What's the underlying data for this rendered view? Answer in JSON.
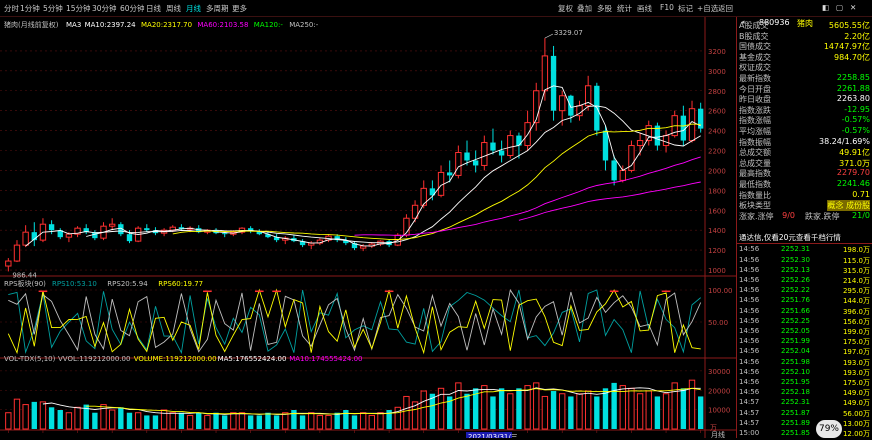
{
  "toolbar": {
    "periods": [
      "分时",
      "1分钟",
      "5分钟",
      "15分钟",
      "30分钟",
      "60分钟",
      "日线",
      "周线",
      "月线",
      "多周期",
      "更多"
    ],
    "active_period": "月线",
    "tools": [
      "复权",
      "叠加",
      "多股",
      "统计",
      "画线",
      "F10",
      "标记",
      "+自选",
      "返回"
    ]
  },
  "main_panel": {
    "title_stock": "猪肉(月线前复权)",
    "ma": [
      {
        "label": "MA3",
        "value": "",
        "color": "#ffffff"
      },
      {
        "label": "MA10:",
        "value": "2397.24",
        "color": "#ffffff"
      },
      {
        "label": "MA20:",
        "value": "2317.70",
        "color": "#ffff00"
      },
      {
        "label": "MA60:",
        "value": "2103.58",
        "color": "#ff00ff"
      },
      {
        "label": "MA120:",
        "value": "-",
        "color": "#00ff00"
      },
      {
        "label": "MA250:",
        "value": "-",
        "color": "#c0c0c0"
      }
    ],
    "price_ticks": [
      "3200",
      "3000",
      "2800",
      "2600",
      "2400",
      "2200",
      "2000",
      "1800",
      "1600",
      "1400",
      "1200",
      "1000"
    ],
    "high_label": "3329.07",
    "low_label": "986.44"
  },
  "rps_panel": {
    "title": "RPS板块(90)",
    "items": [
      {
        "label": "RPS10:",
        "value": "53.10",
        "color": "#00a0a0"
      },
      {
        "label": "RPS20:",
        "value": "5.94",
        "color": "#c0c0c0"
      },
      {
        "label": "RPS60:",
        "value": "19.77",
        "color": "#ffff00"
      }
    ],
    "ticks": [
      "100.00",
      "50.00"
    ]
  },
  "vol_panel": {
    "title": "VOL-TDX(5,10)",
    "items": [
      {
        "label": "VVOL:",
        "value": "119212000.00",
        "color": "#c0c0c0"
      },
      {
        "label": "VOLUME:",
        "value": "119212000.00",
        "color": "#ffff00"
      },
      {
        "label": "MA5:",
        "value": "176552424.00",
        "color": "#ffffff"
      },
      {
        "label": "MA10:",
        "value": "174555424.00",
        "color": "#ff00ff"
      }
    ],
    "ticks": [
      "30000",
      "20000",
      "10000"
    ],
    "unit": "万"
  },
  "date_label": "2021/03/31/三",
  "bottom_right_label": "月线",
  "side": {
    "code": "880936",
    "name": "猪肉",
    "stats": [
      {
        "label": "A股成交",
        "value": "5605.55亿",
        "color": "#ffff00"
      },
      {
        "label": "B股成交",
        "value": "2.20亿",
        "color": "#ffff00"
      },
      {
        "label": "国债成交",
        "value": "14747.97亿",
        "color": "#ffff00"
      },
      {
        "label": "基金成交",
        "value": "984.70亿",
        "color": "#ffff00"
      },
      {
        "label": "权证成交",
        "value": "",
        "color": "#ffff00"
      },
      {
        "label": "最新指数",
        "value": "2258.85",
        "color": "#00ff00"
      },
      {
        "label": "今日开盘",
        "value": "2261.88",
        "color": "#00ff00"
      },
      {
        "label": "昨日收盘",
        "value": "2263.80",
        "color": "#ffffff"
      },
      {
        "label": "指数涨跌",
        "value": "-12.95",
        "color": "#00ff00"
      },
      {
        "label": "指数涨幅",
        "value": "-0.57%",
        "color": "#00ff00"
      },
      {
        "label": "平均涨幅",
        "value": "-0.57%",
        "color": "#00ff00"
      },
      {
        "label": "指数振幅",
        "value": "38.24/1.69%",
        "color": "#ffffff"
      },
      {
        "label": "总成交额",
        "value": "49.91亿",
        "color": "#ffff00"
      },
      {
        "label": "总成交量",
        "value": "371.0万",
        "color": "#ffff00"
      },
      {
        "label": "最高指数",
        "value": "2279.70",
        "color": "#ff4040"
      },
      {
        "label": "最低指数",
        "value": "2241.46",
        "color": "#00ff00"
      },
      {
        "label": "指数量比",
        "value": "0.71",
        "color": "#ffff00"
      },
      {
        "label": "板块类型",
        "value": "概念 成份股",
        "color": "#ffff00"
      },
      {
        "label": "涨家.涨停",
        "value": "9/0",
        "color": "#ff4040"
      },
      {
        "label": "跌家.跌停",
        "value": "21/0",
        "color": "#00ff00"
      }
    ],
    "notice": "通达信,仅看20元查看千档行情",
    "ticks": [
      {
        "time": "14:56",
        "price": "2252.31",
        "vol": "198.0万"
      },
      {
        "time": "14:56",
        "price": "2252.30",
        "vol": "115.0万"
      },
      {
        "time": "14:56",
        "price": "2252.13",
        "vol": "315.0万"
      },
      {
        "time": "14:56",
        "price": "2252.26",
        "vol": "214.0万"
      },
      {
        "time": "14:56",
        "price": "2252.22",
        "vol": "295.0万"
      },
      {
        "time": "14:56",
        "price": "2251.76",
        "vol": "144.0万"
      },
      {
        "time": "14:56",
        "price": "2251.66",
        "vol": "396.0万"
      },
      {
        "time": "14:56",
        "price": "2252.25",
        "vol": "156.0万"
      },
      {
        "time": "14:56",
        "price": "2252.05",
        "vol": "199.0万"
      },
      {
        "time": "14:56",
        "price": "2251.99",
        "vol": "175.0万"
      },
      {
        "time": "14:56",
        "price": "2252.04",
        "vol": "197.0万"
      },
      {
        "time": "14:56",
        "price": "2251.98",
        "vol": "193.0万"
      },
      {
        "time": "14:56",
        "price": "2252.10",
        "vol": "193.0万"
      },
      {
        "time": "14:56",
        "price": "2251.95",
        "vol": "175.0万"
      },
      {
        "time": "14:56",
        "price": "2252.18",
        "vol": "149.0万"
      },
      {
        "time": "14:57",
        "price": "2252.31",
        "vol": "149.0万"
      },
      {
        "time": "14:57",
        "price": "2251.87",
        "vol": "56.00万"
      },
      {
        "time": "14:57",
        "price": "2251.89",
        "vol": "13.00万"
      },
      {
        "time": "15:00",
        "price": "2251.85",
        "vol": "12.00万"
      }
    ]
  },
  "zoom": "79%",
  "chart_data": {
    "type": "candlestick",
    "price_range": [
      960,
      3380
    ],
    "ohlc": [
      [
        1040,
        1120,
        986,
        1090
      ],
      [
        1090,
        1300,
        1080,
        1250
      ],
      [
        1250,
        1450,
        1230,
        1380
      ],
      [
        1380,
        1480,
        1240,
        1300
      ],
      [
        1300,
        1520,
        1280,
        1460
      ],
      [
        1460,
        1500,
        1360,
        1400
      ],
      [
        1400,
        1420,
        1310,
        1330
      ],
      [
        1330,
        1380,
        1280,
        1360
      ],
      [
        1360,
        1440,
        1330,
        1420
      ],
      [
        1420,
        1460,
        1360,
        1380
      ],
      [
        1380,
        1400,
        1300,
        1320
      ],
      [
        1320,
        1480,
        1300,
        1440
      ],
      [
        1440,
        1520,
        1400,
        1460
      ],
      [
        1460,
        1480,
        1340,
        1360
      ],
      [
        1360,
        1400,
        1270,
        1290
      ],
      [
        1290,
        1440,
        1280,
        1420
      ],
      [
        1420,
        1460,
        1380,
        1400
      ],
      [
        1400,
        1430,
        1350,
        1370
      ],
      [
        1370,
        1420,
        1340,
        1400
      ],
      [
        1400,
        1450,
        1380,
        1430
      ],
      [
        1430,
        1460,
        1400,
        1410
      ],
      [
        1410,
        1440,
        1380,
        1420
      ],
      [
        1420,
        1450,
        1370,
        1380
      ],
      [
        1380,
        1410,
        1360,
        1400
      ],
      [
        1400,
        1420,
        1360,
        1370
      ],
      [
        1370,
        1390,
        1330,
        1360
      ],
      [
        1360,
        1400,
        1340,
        1380
      ],
      [
        1380,
        1430,
        1360,
        1420
      ],
      [
        1420,
        1440,
        1370,
        1390
      ],
      [
        1390,
        1410,
        1350,
        1360
      ],
      [
        1360,
        1390,
        1320,
        1330
      ],
      [
        1330,
        1360,
        1280,
        1300
      ],
      [
        1300,
        1340,
        1260,
        1320
      ],
      [
        1320,
        1350,
        1280,
        1290
      ],
      [
        1290,
        1310,
        1230,
        1250
      ],
      [
        1250,
        1290,
        1210,
        1270
      ],
      [
        1270,
        1320,
        1250,
        1300
      ],
      [
        1300,
        1360,
        1280,
        1340
      ],
      [
        1340,
        1360,
        1280,
        1300
      ],
      [
        1300,
        1330,
        1250,
        1270
      ],
      [
        1270,
        1290,
        1200,
        1220
      ],
      [
        1220,
        1260,
        1190,
        1240
      ],
      [
        1240,
        1280,
        1220,
        1260
      ],
      [
        1260,
        1300,
        1240,
        1290
      ],
      [
        1290,
        1310,
        1230,
        1250
      ],
      [
        1250,
        1370,
        1240,
        1350
      ],
      [
        1350,
        1560,
        1330,
        1520
      ],
      [
        1520,
        1700,
        1480,
        1650
      ],
      [
        1650,
        1900,
        1620,
        1820
      ],
      [
        1820,
        1900,
        1700,
        1750
      ],
      [
        1750,
        2050,
        1730,
        1980
      ],
      [
        1980,
        2100,
        1880,
        1950
      ],
      [
        1950,
        2250,
        1920,
        2180
      ],
      [
        2180,
        2300,
        2050,
        2100
      ],
      [
        2100,
        2200,
        1980,
        2050
      ],
      [
        2050,
        2350,
        2000,
        2280
      ],
      [
        2280,
        2420,
        2160,
        2200
      ],
      [
        2200,
        2300,
        2080,
        2150
      ],
      [
        2150,
        2400,
        2120,
        2350
      ],
      [
        2350,
        2380,
        2120,
        2250
      ],
      [
        2250,
        2600,
        2200,
        2480
      ],
      [
        2480,
        2880,
        2400,
        2800
      ],
      [
        2800,
        3329,
        2700,
        3150
      ],
      [
        3150,
        3250,
        2500,
        2600
      ],
      [
        2600,
        2800,
        2450,
        2750
      ],
      [
        2750,
        2760,
        2480,
        2550
      ],
      [
        2550,
        2700,
        2500,
        2650
      ],
      [
        2650,
        2950,
        2600,
        2850
      ],
      [
        2850,
        2880,
        2350,
        2400
      ],
      [
        2400,
        2450,
        2000,
        2100
      ],
      [
        2100,
        2150,
        1850,
        1900
      ],
      [
        1900,
        2050,
        1880,
        2000
      ],
      [
        2000,
        2300,
        1980,
        2250
      ],
      [
        2250,
        2380,
        2150,
        2300
      ],
      [
        2300,
        2500,
        2250,
        2450
      ],
      [
        2450,
        2480,
        2200,
        2250
      ],
      [
        2250,
        2400,
        2180,
        2350
      ],
      [
        2350,
        2600,
        2330,
        2550
      ],
      [
        2550,
        2650,
        2250,
        2300
      ],
      [
        2300,
        2700,
        2280,
        2620
      ],
      [
        2620,
        2680,
        2380,
        2420
      ]
    ],
    "volume": [
      6,
      11,
      9,
      10,
      10,
      8,
      7,
      6,
      8,
      9,
      6,
      9,
      7,
      8,
      6,
      6,
      5,
      5,
      7,
      6,
      6,
      5,
      6,
      5,
      6,
      5,
      6,
      6,
      5,
      5,
      6,
      5,
      6,
      7,
      5,
      6,
      5,
      5,
      6,
      7,
      5,
      6,
      5,
      6,
      7,
      8,
      12,
      10,
      14,
      13,
      15,
      12,
      17,
      13,
      15,
      16,
      12,
      15,
      13,
      15,
      16,
      17,
      12,
      14,
      13,
      12,
      13,
      14,
      12,
      15,
      17,
      16,
      15,
      13,
      14,
      12,
      13,
      17,
      15,
      18,
      12
    ],
    "volume_range": [
      0,
      32000
    ]
  }
}
